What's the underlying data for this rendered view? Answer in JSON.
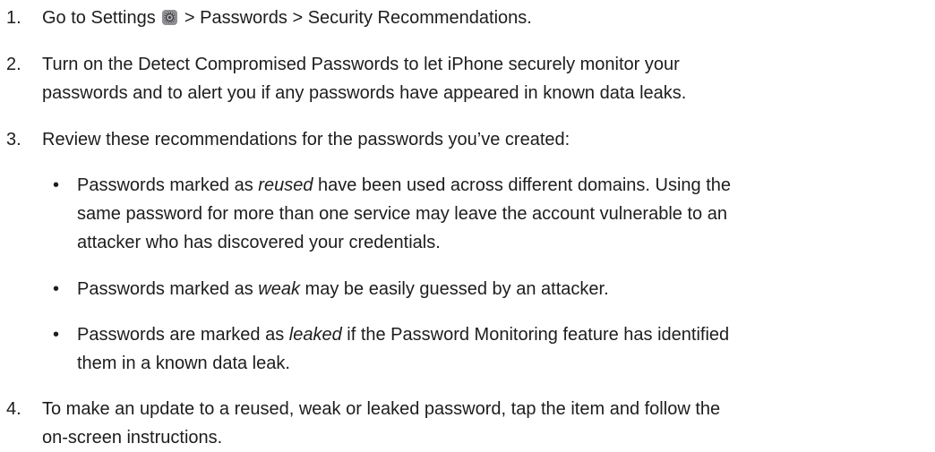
{
  "steps": [
    {
      "num": "1.",
      "pre": "Go to Settings",
      "icon": "settings-gear-icon",
      "post": "> Passwords > Security Recommendations."
    },
    {
      "num": "2.",
      "lines": [
        "Turn on the Detect Compromised Passwords to let iPhone securely monitor your",
        "passwords and to alert you if any passwords have appeared in known data leaks."
      ]
    },
    {
      "num": "3.",
      "text": "Review these recommendations for the passwords you’ve created:",
      "bullets": [
        {
          "pre": "Passwords marked as ",
          "em": "reused",
          "post": " have been used across different domains. Using the",
          "lines": [
            "same password for more than one service may leave the account vulnerable to an",
            "attacker who has discovered your credentials."
          ]
        },
        {
          "pre": "Passwords marked as ",
          "em": "weak",
          "post": " may be easily guessed by an attacker."
        },
        {
          "pre": "Passwords are marked as ",
          "em": "leaked",
          "post": " if the Password Monitoring feature has identified",
          "lines": [
            "them in a known data leak."
          ]
        }
      ]
    },
    {
      "num": "4.",
      "lines": [
        "To make an update to a reused, weak or leaked password, tap the item and follow the",
        "on-screen instructions."
      ]
    }
  ],
  "bullet_char": "•"
}
